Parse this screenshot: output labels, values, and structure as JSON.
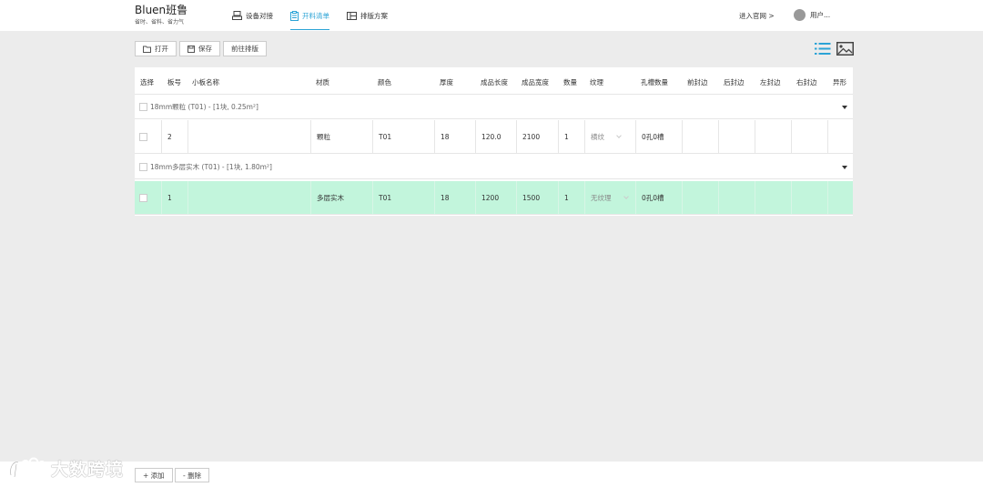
{
  "brand": {
    "name": "Bluen班鲁",
    "slogan": "省时、省料、省力气"
  },
  "nav": [
    {
      "label": "设备对接",
      "icon": "device-icon",
      "active": false
    },
    {
      "label": "开料清单",
      "icon": "clipboard-icon",
      "active": true
    },
    {
      "label": "排版方案",
      "icon": "layout-icon",
      "active": false
    }
  ],
  "header": {
    "official_link": "进入官网 >",
    "user": "用户..."
  },
  "toolbar": {
    "open": "打开",
    "save": "保存",
    "goto_layout": "前往排版"
  },
  "table": {
    "headers": [
      "选择",
      "板号",
      "小板名称",
      "材质",
      "颜色",
      "厚度",
      "成品长度",
      "成品宽度",
      "数量",
      "纹理",
      "孔槽数量",
      "前封边",
      "后封边",
      "左封边",
      "右封边",
      "异形"
    ],
    "groups": [
      {
        "title": "18mm颗粒 (T01) - [1块, 0.25m²]",
        "rows": [
          {
            "no": "2",
            "name": "",
            "material": "颗粒",
            "color": "T01",
            "thickness": "18",
            "length": "120.0",
            "width": "2100",
            "qty": "1",
            "texture": "横纹",
            "holes": "0孔0槽",
            "selected": false
          }
        ]
      },
      {
        "title": "18mm多层实木 (T01) - [1块, 1.80m²]",
        "rows": [
          {
            "no": "1",
            "name": "",
            "material": "多层实木",
            "color": "T01",
            "thickness": "18",
            "length": "1200",
            "width": "1500",
            "qty": "1",
            "texture": "无纹理",
            "holes": "0孔0槽",
            "selected": true
          }
        ]
      }
    ]
  },
  "footer": {
    "add": "+ 添加",
    "delete": "- 删除"
  },
  "watermark": "大数跨境",
  "colors": {
    "accent": "#2ba3d6",
    "selected_row": "#c2f5dc"
  }
}
